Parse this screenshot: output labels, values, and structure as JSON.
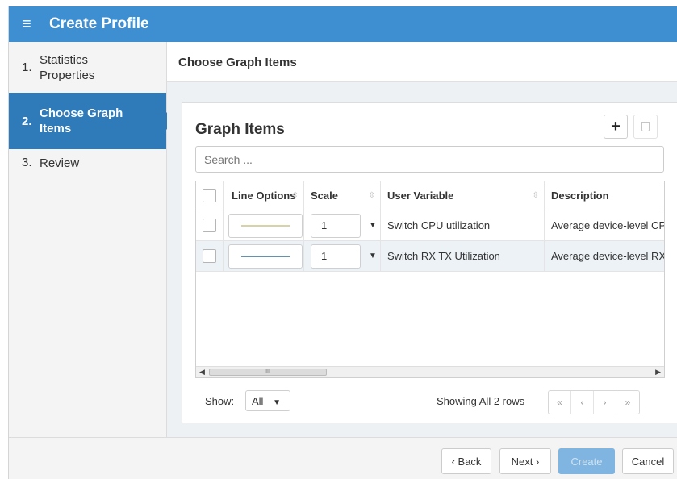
{
  "window": {
    "title": "Create Profile"
  },
  "steps": [
    {
      "num": "1.",
      "label": "Statistics Properties",
      "active": false
    },
    {
      "num": "2.",
      "label": "Choose Graph Items",
      "active": true
    },
    {
      "num": "3.",
      "label": "Review",
      "active": false
    }
  ],
  "main": {
    "header": "Choose Graph Items"
  },
  "panel": {
    "title": "Graph Items",
    "add_label": "+",
    "search_placeholder": "Search ..."
  },
  "table": {
    "columns": [
      "Line Options",
      "Scale",
      "User Variable",
      "Description"
    ],
    "rows": [
      {
        "line_color": "#d8d3a6",
        "scale": "1",
        "user_variable": "Switch CPU utilization",
        "description": "Average device-level CPU utilization"
      },
      {
        "line_color": "#6d8fa5",
        "scale": "1",
        "user_variable": "Switch RX TX Utilization",
        "description": "Average device-level RX TX utilization"
      }
    ],
    "scroll_thumb_label": "III"
  },
  "footer": {
    "show_label": "Show:",
    "show_value": "All",
    "rows_info": "Showing All 2 rows",
    "pager": [
      "«",
      "‹",
      "›",
      "»"
    ]
  },
  "actions": {
    "back": "‹ Back",
    "next": "Next ›",
    "create": "Create",
    "cancel": "Cancel"
  },
  "colors": {
    "titlebar": "#3d8fd1",
    "active_step": "#2f7ab9",
    "create_disabled": "#7fb5e0"
  }
}
